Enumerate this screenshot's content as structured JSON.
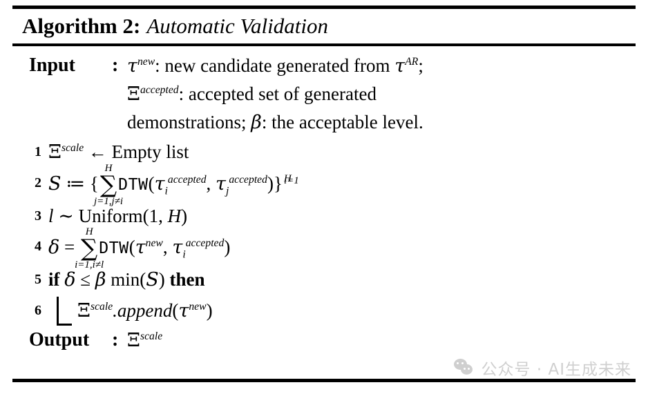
{
  "document": {
    "type": "algorithm-pseudocode",
    "background_color": "#ffffff",
    "text_color": "#000000"
  },
  "algorithm": {
    "keyword": "Algorithm 2:",
    "name": "Automatic Validation",
    "input": {
      "label": "Input",
      "colon": ":",
      "lines": [
        "τ^new: new candidate generated from τ^AR;",
        "Ξ^accepted: accepted set of generated",
        "demonstrations; β: the acceptable level."
      ],
      "line1": {
        "tau": "τ",
        "tau_sup": "new",
        "text_mid": ": new candidate generated from ",
        "tau2": "τ",
        "tau2_sup": "AR",
        "text_end": ";"
      },
      "line2": {
        "xi": "Ξ",
        "xi_sup": "accepted",
        "text": ": accepted set of generated"
      },
      "line3": {
        "text_start": "demonstrations; ",
        "beta": "β",
        "text_end": ": the acceptable level."
      }
    },
    "steps": [
      {
        "number": "1",
        "text": "Ξ^scale ← Empty list",
        "parts": {
          "xi": "Ξ",
          "xi_sup": "scale",
          "arrow": "←",
          "rhs": "Empty list"
        }
      },
      {
        "number": "2",
        "text": "S := {Σ_{j=1,j≠i}^{H} DTW(τ_i^accepted, τ_j^accepted)}_{i=1}^{H}",
        "parts": {
          "lhs": "S",
          "assign": "≔",
          "open_brace": "{",
          "sum": "∑",
          "sum_top": "H",
          "sum_bot": "j=1,j≠i",
          "func": "DTW",
          "open_paren": "(",
          "arg1_sym": "τ",
          "arg1_sub": "i",
          "arg1_sup": "accepted",
          "comma": ",",
          "arg2_sym": "τ",
          "arg2_sub": "j",
          "arg2_sup": "accepted",
          "close_paren": ")",
          "close_brace": "}",
          "set_top": "H",
          "set_bot": "i=1"
        }
      },
      {
        "number": "3",
        "text": "l ~ Uniform(1, H)",
        "parts": {
          "var": "l",
          "tilde": "∼",
          "dist": "Uniform",
          "open_paren": "(",
          "arg1": "1",
          "comma": ",",
          "arg2": "H",
          "close_paren": ")"
        }
      },
      {
        "number": "4",
        "text": "δ = Σ_{i=1,i≠l}^{H} DTW(τ^new, τ_i^accepted)",
        "parts": {
          "lhs": "δ",
          "eq": "=",
          "sum": "∑",
          "sum_top": "H",
          "sum_bot": "i=1,i≠l",
          "func": "DTW",
          "open_paren": "(",
          "arg1_sym": "τ",
          "arg1_sup": "new",
          "comma": ",",
          "arg2_sym": "τ",
          "arg2_sub": "i",
          "arg2_sup": "accepted",
          "close_paren": ")"
        }
      },
      {
        "number": "5",
        "text": "if δ ≤ β min(S) then",
        "parts": {
          "kw_if": "if",
          "delta": "δ",
          "leq": "≤",
          "beta": "β",
          "min": "min",
          "open_paren": "(",
          "set": "S",
          "close_paren": ")",
          "kw_then": "then"
        }
      },
      {
        "number": "6",
        "text": "Ξ^scale.append(τ^new)",
        "parts": {
          "xi": "Ξ",
          "xi_sup": "scale",
          "method": ".append",
          "open_paren": "(",
          "arg_sym": "τ",
          "arg_sup": "new",
          "close_paren": ")"
        }
      }
    ],
    "output": {
      "label": "Output",
      "colon": ":",
      "value_sym": "Ξ",
      "value_sup": "scale",
      "text": "Ξ^scale"
    }
  },
  "watermark": {
    "icon": "wechat-logo-icon",
    "text": "公众号 · AI生成未来",
    "color": "#cfcfcf"
  }
}
